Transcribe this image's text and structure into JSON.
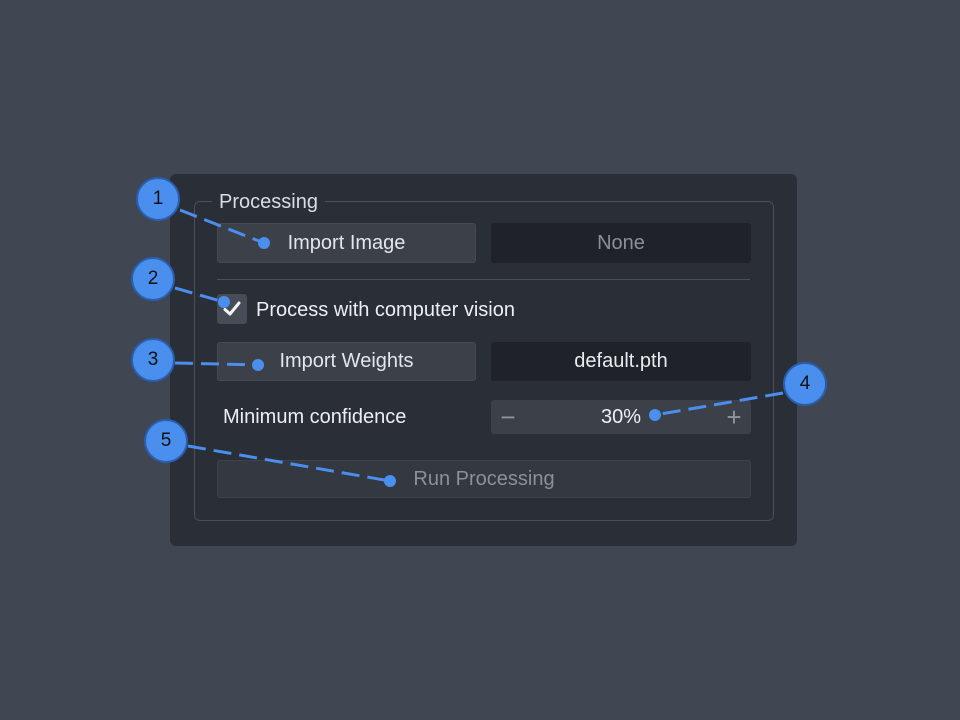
{
  "group": {
    "title": "Processing"
  },
  "import_image": {
    "button_label": "Import Image",
    "filename": "None"
  },
  "computer_vision": {
    "checkbox_label": "Process with computer vision",
    "checked": true
  },
  "import_weights": {
    "button_label": "Import Weights",
    "filename": "default.pth"
  },
  "confidence": {
    "label": "Minimum confidence",
    "value": "30%",
    "decrement_symbol": "−",
    "increment_symbol": "+"
  },
  "run": {
    "button_label": "Run Processing",
    "enabled": false
  },
  "callouts": [
    {
      "number": "1"
    },
    {
      "number": "2"
    },
    {
      "number": "3"
    },
    {
      "number": "4"
    },
    {
      "number": "5"
    }
  ],
  "colors": {
    "background": "#414752",
    "panel": "#2a2e36",
    "callout": "#4a8eee"
  },
  "icons": {
    "checkbox": "check-mark-icon"
  }
}
